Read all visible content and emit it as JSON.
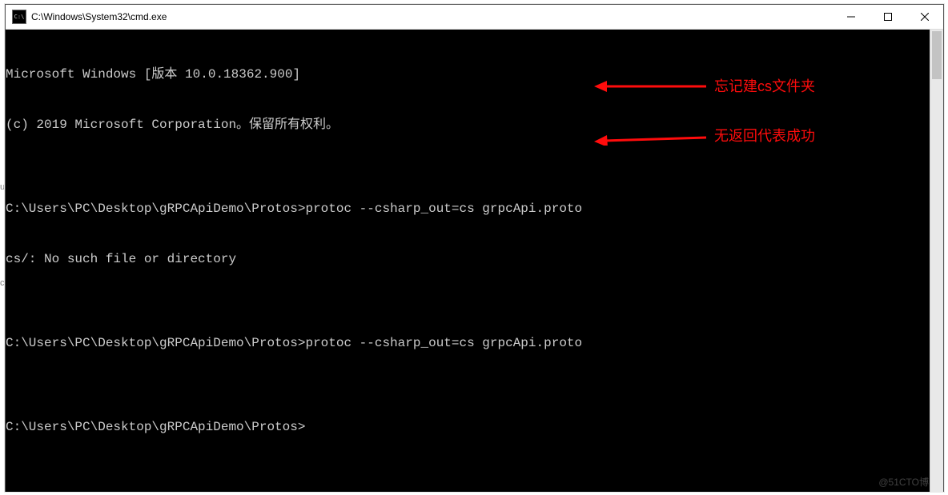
{
  "window": {
    "title": "C:\\Windows\\System32\\cmd.exe",
    "icon_label": "C:\\",
    "controls": {
      "minimize": "minimize",
      "maximize": "maximize",
      "close": "close"
    }
  },
  "terminal": {
    "lines": [
      "Microsoft Windows [版本 10.0.18362.900]",
      "(c) 2019 Microsoft Corporation。保留所有权利。",
      "",
      "C:\\Users\\PC\\Desktop\\gRPCApiDemo\\Protos>protoc --csharp_out=cs grpcApi.proto",
      "cs/: No such file or directory",
      "",
      "C:\\Users\\PC\\Desktop\\gRPCApiDemo\\Protos>protoc --csharp_out=cs grpcApi.proto",
      "",
      "C:\\Users\\PC\\Desktop\\gRPCApiDemo\\Protos>"
    ]
  },
  "annotations": {
    "arrow1_label": "忘记建cs文件夹",
    "arrow2_label": "无返回代表成功"
  },
  "watermark": "@51CTO博",
  "colors": {
    "annotation_red": "#ff0c0c",
    "terminal_fg": "#cccccc",
    "terminal_bg": "#000000"
  }
}
